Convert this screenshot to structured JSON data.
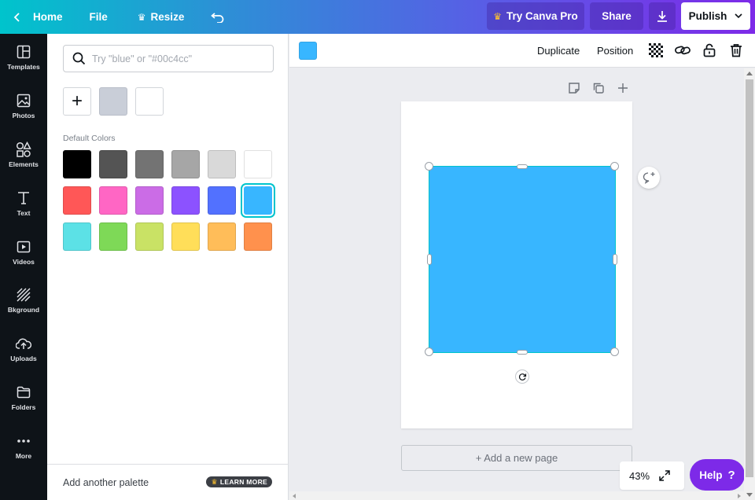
{
  "topbar": {
    "home_label": "Home",
    "file_label": "File",
    "resize_label": "Resize",
    "try_pro_label": "Try Canva Pro",
    "share_label": "Share",
    "publish_label": "Publish"
  },
  "rail": {
    "items": [
      {
        "label": "Templates",
        "icon": "templates-icon"
      },
      {
        "label": "Photos",
        "icon": "photos-icon"
      },
      {
        "label": "Elements",
        "icon": "elements-icon"
      },
      {
        "label": "Text",
        "icon": "text-icon"
      },
      {
        "label": "Videos",
        "icon": "videos-icon"
      },
      {
        "label": "Bkground",
        "icon": "background-icon"
      },
      {
        "label": "Uploads",
        "icon": "uploads-icon"
      },
      {
        "label": "Folders",
        "icon": "folders-icon"
      },
      {
        "label": "More",
        "icon": "more-icon"
      }
    ]
  },
  "panel": {
    "search_placeholder": "Try \"blue\" or \"#00c4cc\"",
    "search_value": "",
    "add_color_glyph": "+",
    "document_colors": [
      "#c9ced8",
      "#ffffff"
    ],
    "default_colors_title": "Default Colors",
    "default_colors": [
      "#000000",
      "#545454",
      "#737373",
      "#a6a6a6",
      "#d9d9d9",
      "#ffffff",
      "#ff5757",
      "#ff66c4",
      "#cb6ce6",
      "#8c52ff",
      "#5271ff",
      "#38b6ff",
      "#5ce1e6",
      "#7ed957",
      "#c9e265",
      "#ffde59",
      "#ffbd59",
      "#ff914d"
    ],
    "selected_color": "#38b6ff",
    "add_palette_label": "Add another palette",
    "learn_more_label": "LEARN MORE"
  },
  "toolbar": {
    "current_color": "#38b6ff",
    "duplicate_label": "Duplicate",
    "position_label": "Position"
  },
  "canvas": {
    "shape_color": "#38b6ff",
    "add_page_label": "+ Add a new page"
  },
  "footer": {
    "zoom_label": "43%",
    "help_label": "Help",
    "help_glyph": "?"
  },
  "colors": {
    "accent": "#00c4cc",
    "brand_purple": "#7d2ae8",
    "rail_bg": "#0e1318"
  }
}
